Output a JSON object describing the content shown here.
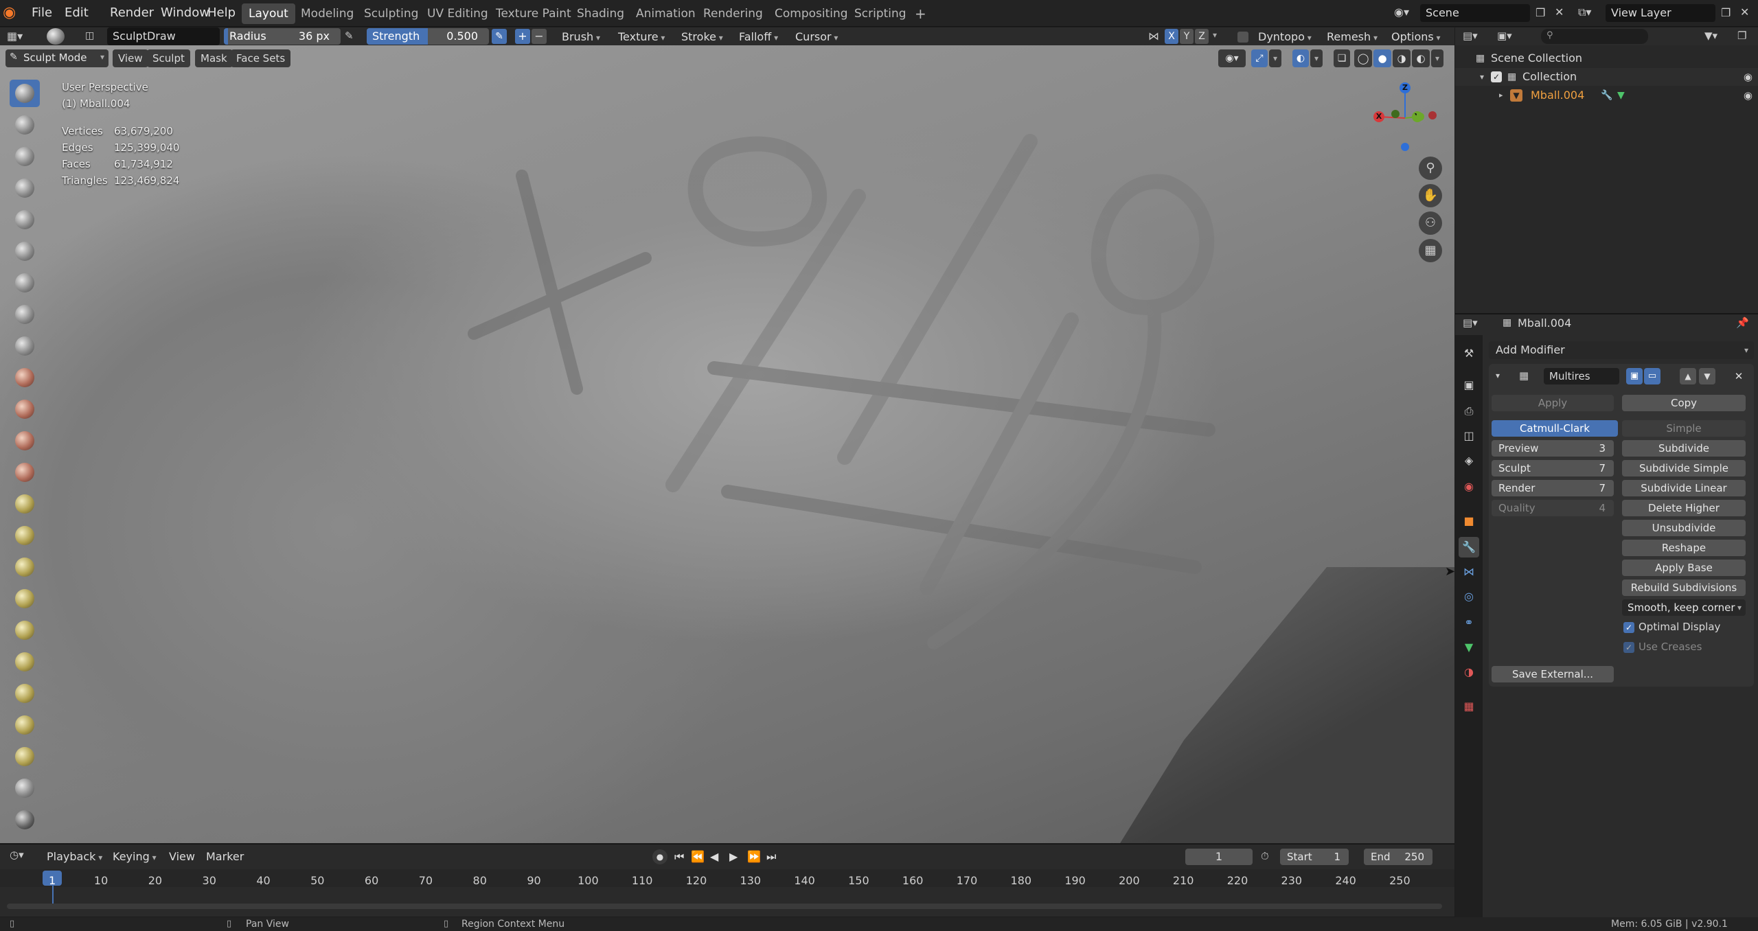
{
  "topbar": {
    "menus": [
      "File",
      "Edit",
      "Render",
      "Window",
      "Help"
    ],
    "workspaces": [
      "Layout",
      "Modeling",
      "Sculpting",
      "UV Editing",
      "Texture Paint",
      "Shading",
      "Animation",
      "Rendering",
      "Compositing",
      "Scripting"
    ],
    "active_workspace": "Layout",
    "scene": "Scene",
    "view_layer": "View Layer"
  },
  "tool_settings": {
    "brush_name": "SculptDraw",
    "radius_label": "Radius",
    "radius_value": "36 px",
    "strength_label": "Strength",
    "strength_value": "0.500",
    "strength_fraction": 0.5,
    "menus": [
      "Brush",
      "Texture",
      "Stroke",
      "Falloff",
      "Cursor"
    ],
    "axes": [
      "X",
      "Y",
      "Z"
    ],
    "dyntopo": "Dyntopo",
    "remesh": "Remesh",
    "options": "Options"
  },
  "viewport_header": {
    "mode": "Sculpt Mode",
    "menus": [
      "View",
      "Sculpt",
      "Mask",
      "Face Sets"
    ]
  },
  "overlay": {
    "perspective": "User Perspective",
    "object": "(1) Mball.004",
    "stats": [
      {
        "label": "Vertices",
        "value": "63,679,200"
      },
      {
        "label": "Edges",
        "value": "125,399,040"
      },
      {
        "label": "Faces",
        "value": "61,734,912"
      },
      {
        "label": "Triangles",
        "value": "123,469,824"
      }
    ]
  },
  "gizmo": {
    "x": "X",
    "y": "Y",
    "z": "Z"
  },
  "outliner": {
    "search_placeholder": "",
    "scene_collection": "Scene Collection",
    "collection": "Collection",
    "object": "Mball.004"
  },
  "properties": {
    "object_name": "Mball.004",
    "add_modifier": "Add Modifier",
    "modifier_name": "Multires",
    "apply": "Apply",
    "copy": "Copy",
    "catmull": "Catmull-Clark",
    "simple": "Simple",
    "levels": [
      {
        "label": "Preview",
        "value": "3"
      },
      {
        "label": "Sculpt",
        "value": "7"
      },
      {
        "label": "Render",
        "value": "7"
      },
      {
        "label": "Quality",
        "value": "4"
      }
    ],
    "ops": [
      "Subdivide",
      "Subdivide Simple",
      "Subdivide Linear",
      "Delete Higher",
      "Unsubdivide",
      "Reshape",
      "Apply Base",
      "Rebuild Subdivisions"
    ],
    "uv_smooth": "Smooth, keep corner",
    "optimal_display": "Optimal Display",
    "use_creases": "Use Creases",
    "save_external": "Save External..."
  },
  "timeline": {
    "menus": [
      "Playback",
      "Keying",
      "View",
      "Marker"
    ],
    "current_frame": "1",
    "start_label": "Start",
    "start": "1",
    "end_label": "End",
    "end": "250",
    "ticks": [
      "1",
      "10",
      "20",
      "30",
      "40",
      "50",
      "60",
      "70",
      "80",
      "90",
      "100",
      "110",
      "120",
      "130",
      "140",
      "150",
      "160",
      "170",
      "180",
      "190",
      "200",
      "210",
      "220",
      "230",
      "240",
      "250"
    ]
  },
  "statusbar": {
    "pan": "Pan View",
    "context": "Region Context Menu",
    "mem": "Mem: 6.05 GiB | v2.90.1"
  }
}
